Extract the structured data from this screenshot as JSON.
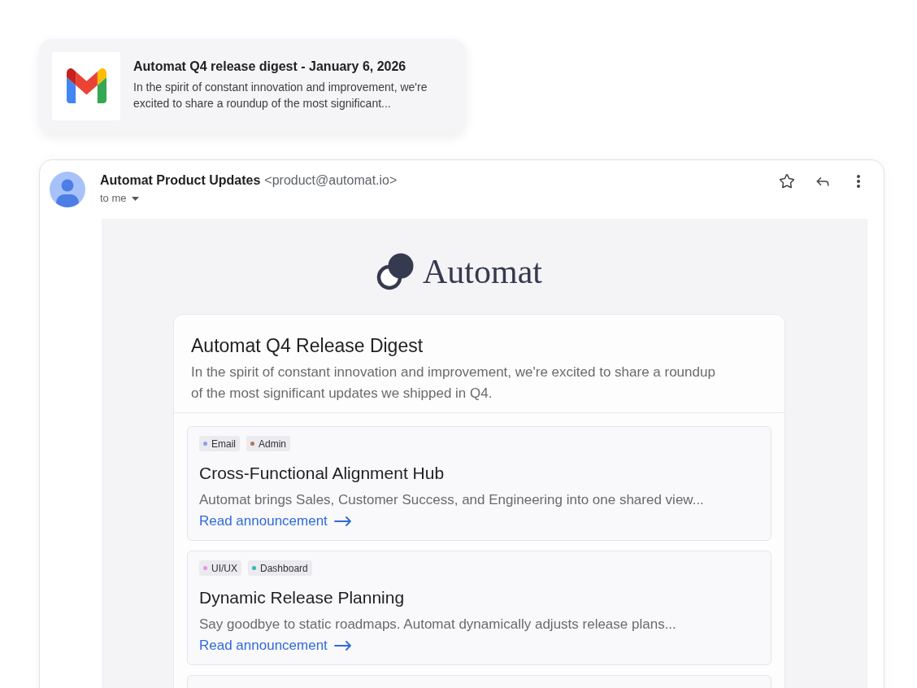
{
  "notification": {
    "title": "Automat Q4 release digest - January 6, 2026",
    "preview": "In the spirit of constant innovation and improvement, we're excited to share a roundup of the most significant..."
  },
  "email": {
    "sender_name": "Automat Product Updates",
    "sender_address": "<product@automat.io>",
    "recipient": "to me",
    "newsletter": {
      "logo_text": "Automat",
      "title": "Automat Q4 Release Digest",
      "intro": "In the spirit of constant innovation and improvement, we're excited to share a roundup of the most significant updates we shipped in Q4.",
      "updates": [
        {
          "tags": [
            {
              "label": "Email",
              "color": "#8e9bf0"
            },
            {
              "label": "Admin",
              "color": "#b27650"
            }
          ],
          "title": "Cross-Functional Alignment Hub",
          "summary": "Automat brings Sales, Customer Success, and Engineering into one shared view...",
          "link": "Read announcement"
        },
        {
          "tags": [
            {
              "label": "UI/UX",
              "color": "#ec8ee8"
            },
            {
              "label": "Dashboard",
              "color": "#2fb8b8"
            }
          ],
          "title": "Dynamic Release Planning",
          "summary": "Say goodbye to static roadmaps. Automat dynamically adjusts release plans...",
          "link": "Read announcement"
        }
      ]
    }
  }
}
